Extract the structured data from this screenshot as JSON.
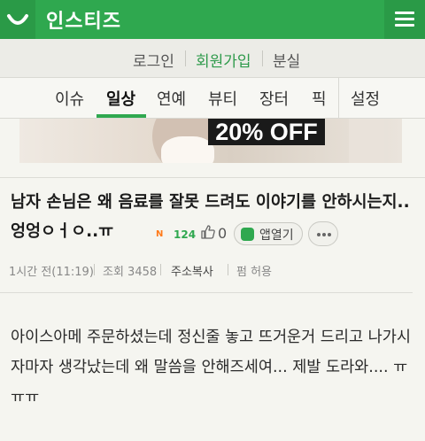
{
  "header": {
    "brand": "인스티즈",
    "logo_icon": "smile-logo-icon",
    "menu_icon": "hamburger-menu-icon",
    "accent_color": "#2fa84f"
  },
  "auth": {
    "login": "로그인",
    "signup": "회원가입",
    "lost": "분실"
  },
  "tabs": [
    {
      "label": "이슈"
    },
    {
      "label": "일상",
      "active": true
    },
    {
      "label": "연예"
    },
    {
      "label": "뷰티"
    },
    {
      "label": "장터"
    },
    {
      "label": "픽"
    },
    {
      "label": "설정"
    }
  ],
  "banner": {
    "text": "20% OFF"
  },
  "post": {
    "title": "남자 손님은 왜 음료를 잘못 드려도 이야기를 안하시는지.. 엉엉ㅇㅓㅇ..ㅠ",
    "hot_badge": "N",
    "hot_count": "124",
    "like_icon": "thumbs-up-icon",
    "like_count": "0",
    "app_open_label": "앱열기",
    "more_icon": "more-dots-icon",
    "meta": {
      "time": "1시간 전(11:19)",
      "views": "조회 3458",
      "copy_url": "주소복사",
      "permission": "펌 허용"
    },
    "body": "아이스아메 주문하셨는데 정신줄 놓고 뜨거운거 드리고 나가시자마자 생각났는데 왜 말씀을 안해즈세여... 제발 도라와.... ㅠㅠㅠ"
  }
}
